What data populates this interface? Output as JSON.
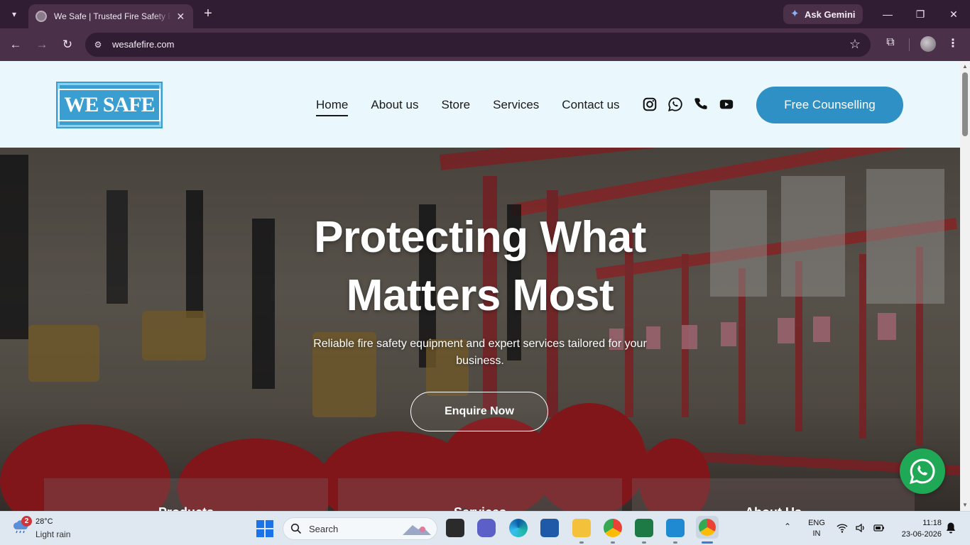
{
  "browser": {
    "tab_title": "We Safe | Trusted Fire Safety Eq",
    "tab_close": "✕",
    "new_tab": "+",
    "ask_gemini": "Ask Gemini",
    "url": "wesafefire.com",
    "window_controls": [
      "—",
      "❐",
      "✕"
    ]
  },
  "site": {
    "logo_text": "WE SAFE",
    "nav": [
      {
        "label": "Home",
        "active": true
      },
      {
        "label": "About us",
        "active": false
      },
      {
        "label": "Store",
        "active": false
      },
      {
        "label": "Services",
        "active": false
      },
      {
        "label": "Contact us",
        "active": false
      }
    ],
    "social_icons": [
      "instagram-icon",
      "whatsapp-icon",
      "phone-icon",
      "youtube-icon"
    ],
    "cta_label": "Free Counselling"
  },
  "hero": {
    "title": "Protecting What Matters Most",
    "subtitle": "Reliable fire safety equipment and expert services tailored for your business.",
    "button": "Enquire Now",
    "cards": [
      "Products",
      "Services",
      "About Us"
    ]
  },
  "taskbar": {
    "weather_badge": "2",
    "temperature": "28°C",
    "weather": "Light rain",
    "search_label": "Search",
    "lang_top": "ENG",
    "lang_bottom": "IN",
    "time": "11:18",
    "date": "23-06-2026"
  },
  "colors": {
    "accent": "#2e90c4",
    "header_bg": "#eaf8fd",
    "whatsapp": "#1fa855"
  }
}
